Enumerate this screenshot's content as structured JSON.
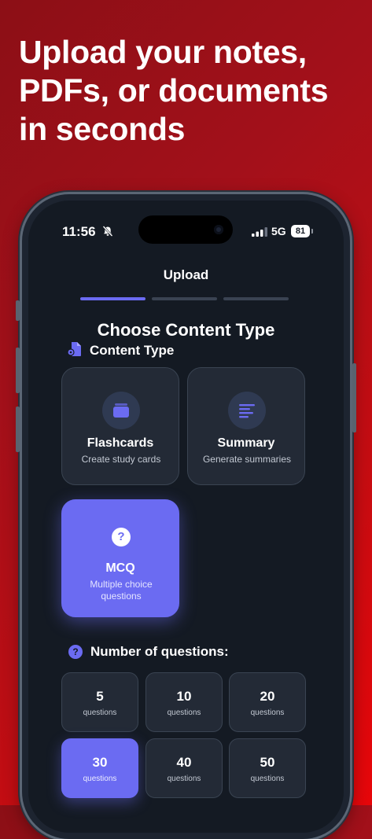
{
  "headline": "Upload your notes, PDFs, or documents in seconds",
  "status_bar": {
    "time": "11:56",
    "network": "5G",
    "battery": "81"
  },
  "nav": {
    "title": "Upload"
  },
  "progress": {
    "total_steps": 3,
    "current_step": 1
  },
  "section": {
    "title": "Choose Content Type",
    "content_type_label": "Content Type"
  },
  "content_types": [
    {
      "title": "Flashcards",
      "subtitle": "Create study cards",
      "icon": "cards-stack-icon",
      "selected": false
    },
    {
      "title": "Summary",
      "subtitle": "Generate summaries",
      "icon": "text-lines-icon",
      "selected": false
    },
    {
      "title": "MCQ",
      "subtitle": "Multiple choice questions",
      "icon": "question-circle-icon",
      "selected": true
    }
  ],
  "questions": {
    "label": "Number of questions:",
    "unit": "questions",
    "options": [
      "5",
      "10",
      "20",
      "30",
      "40",
      "50"
    ],
    "selected": "30"
  },
  "colors": {
    "accent": "#6b6bf2",
    "background": "#141a23",
    "card": "#232a36",
    "gradient_start": "#8c0f16",
    "gradient_end": "#e8060a"
  }
}
